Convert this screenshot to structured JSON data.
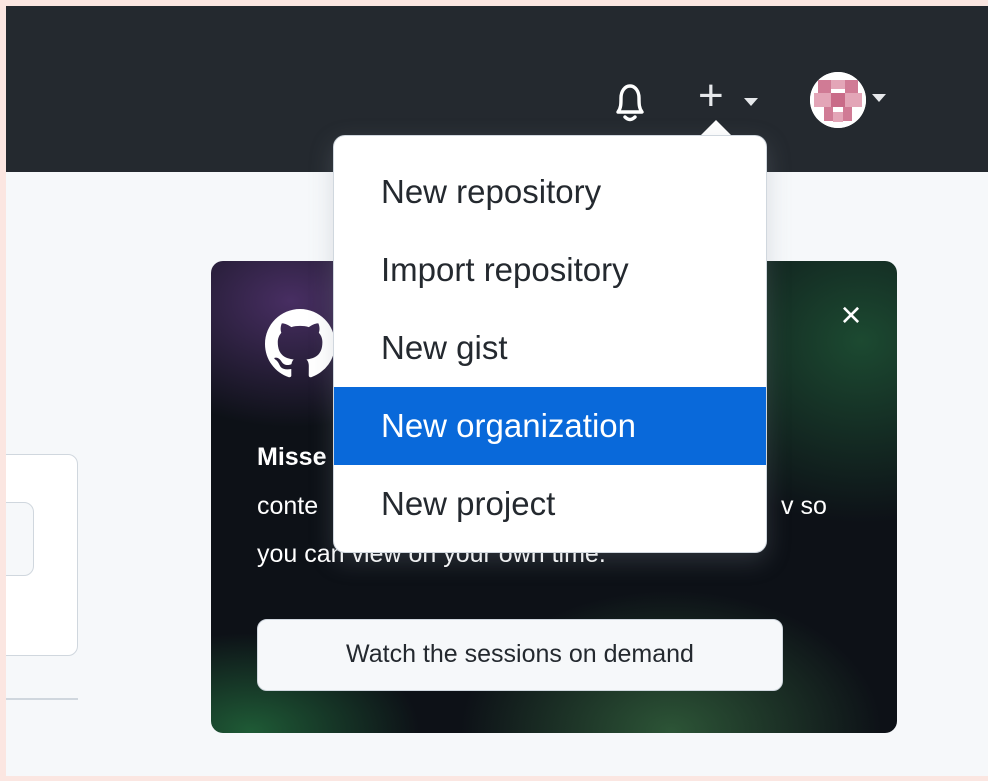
{
  "header": {
    "notifications_icon": "bell-icon",
    "create_icon": "plus-icon",
    "create_glyph": "+",
    "avatar_icon": "identicon-avatar"
  },
  "create_menu": {
    "items": [
      {
        "label": "New repository",
        "active": false
      },
      {
        "label": "Import repository",
        "active": false
      },
      {
        "label": "New gist",
        "active": false
      },
      {
        "label": "New organization",
        "active": true
      },
      {
        "label": "New project",
        "active": false
      }
    ]
  },
  "promo_card": {
    "logo_icon": "github-mark-icon",
    "close_glyph": "×",
    "title_visible": "Misse",
    "line1_visible_start": "conte",
    "line1_visible_end": "v so",
    "line2_visible": "you can view on your own time.",
    "button_label": "Watch the sessions on demand"
  },
  "colors": {
    "topbar": "#24292f",
    "accent": "#0969da",
    "page_bg": "#f6f8fa",
    "outer_bg": "#fbe6e1",
    "card_bg": "#0d1117"
  }
}
